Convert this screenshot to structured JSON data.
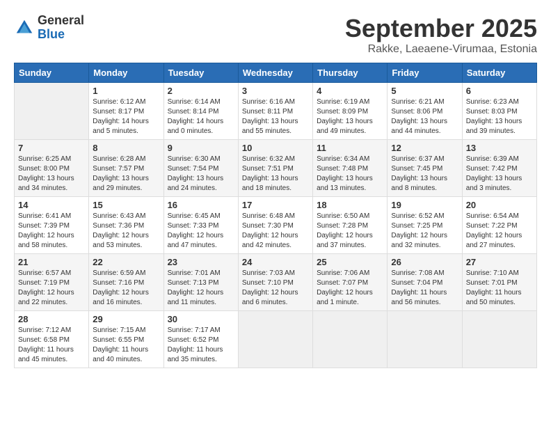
{
  "header": {
    "logo_general": "General",
    "logo_blue": "Blue",
    "month_title": "September 2025",
    "subtitle": "Rakke, Laeaene-Virumaa, Estonia"
  },
  "days_of_week": [
    "Sunday",
    "Monday",
    "Tuesday",
    "Wednesday",
    "Thursday",
    "Friday",
    "Saturday"
  ],
  "weeks": [
    [
      {
        "day": "",
        "empty": true
      },
      {
        "day": "1",
        "sunrise": "Sunrise: 6:12 AM",
        "sunset": "Sunset: 8:17 PM",
        "daylight": "Daylight: 14 hours and 5 minutes."
      },
      {
        "day": "2",
        "sunrise": "Sunrise: 6:14 AM",
        "sunset": "Sunset: 8:14 PM",
        "daylight": "Daylight: 14 hours and 0 minutes."
      },
      {
        "day": "3",
        "sunrise": "Sunrise: 6:16 AM",
        "sunset": "Sunset: 8:11 PM",
        "daylight": "Daylight: 13 hours and 55 minutes."
      },
      {
        "day": "4",
        "sunrise": "Sunrise: 6:19 AM",
        "sunset": "Sunset: 8:09 PM",
        "daylight": "Daylight: 13 hours and 49 minutes."
      },
      {
        "day": "5",
        "sunrise": "Sunrise: 6:21 AM",
        "sunset": "Sunset: 8:06 PM",
        "daylight": "Daylight: 13 hours and 44 minutes."
      },
      {
        "day": "6",
        "sunrise": "Sunrise: 6:23 AM",
        "sunset": "Sunset: 8:03 PM",
        "daylight": "Daylight: 13 hours and 39 minutes."
      }
    ],
    [
      {
        "day": "7",
        "sunrise": "Sunrise: 6:25 AM",
        "sunset": "Sunset: 8:00 PM",
        "daylight": "Daylight: 13 hours and 34 minutes."
      },
      {
        "day": "8",
        "sunrise": "Sunrise: 6:28 AM",
        "sunset": "Sunset: 7:57 PM",
        "daylight": "Daylight: 13 hours and 29 minutes."
      },
      {
        "day": "9",
        "sunrise": "Sunrise: 6:30 AM",
        "sunset": "Sunset: 7:54 PM",
        "daylight": "Daylight: 13 hours and 24 minutes."
      },
      {
        "day": "10",
        "sunrise": "Sunrise: 6:32 AM",
        "sunset": "Sunset: 7:51 PM",
        "daylight": "Daylight: 13 hours and 18 minutes."
      },
      {
        "day": "11",
        "sunrise": "Sunrise: 6:34 AM",
        "sunset": "Sunset: 7:48 PM",
        "daylight": "Daylight: 13 hours and 13 minutes."
      },
      {
        "day": "12",
        "sunrise": "Sunrise: 6:37 AM",
        "sunset": "Sunset: 7:45 PM",
        "daylight": "Daylight: 13 hours and 8 minutes."
      },
      {
        "day": "13",
        "sunrise": "Sunrise: 6:39 AM",
        "sunset": "Sunset: 7:42 PM",
        "daylight": "Daylight: 13 hours and 3 minutes."
      }
    ],
    [
      {
        "day": "14",
        "sunrise": "Sunrise: 6:41 AM",
        "sunset": "Sunset: 7:39 PM",
        "daylight": "Daylight: 12 hours and 58 minutes."
      },
      {
        "day": "15",
        "sunrise": "Sunrise: 6:43 AM",
        "sunset": "Sunset: 7:36 PM",
        "daylight": "Daylight: 12 hours and 53 minutes."
      },
      {
        "day": "16",
        "sunrise": "Sunrise: 6:45 AM",
        "sunset": "Sunset: 7:33 PM",
        "daylight": "Daylight: 12 hours and 47 minutes."
      },
      {
        "day": "17",
        "sunrise": "Sunrise: 6:48 AM",
        "sunset": "Sunset: 7:30 PM",
        "daylight": "Daylight: 12 hours and 42 minutes."
      },
      {
        "day": "18",
        "sunrise": "Sunrise: 6:50 AM",
        "sunset": "Sunset: 7:28 PM",
        "daylight": "Daylight: 12 hours and 37 minutes."
      },
      {
        "day": "19",
        "sunrise": "Sunrise: 6:52 AM",
        "sunset": "Sunset: 7:25 PM",
        "daylight": "Daylight: 12 hours and 32 minutes."
      },
      {
        "day": "20",
        "sunrise": "Sunrise: 6:54 AM",
        "sunset": "Sunset: 7:22 PM",
        "daylight": "Daylight: 12 hours and 27 minutes."
      }
    ],
    [
      {
        "day": "21",
        "sunrise": "Sunrise: 6:57 AM",
        "sunset": "Sunset: 7:19 PM",
        "daylight": "Daylight: 12 hours and 22 minutes."
      },
      {
        "day": "22",
        "sunrise": "Sunrise: 6:59 AM",
        "sunset": "Sunset: 7:16 PM",
        "daylight": "Daylight: 12 hours and 16 minutes."
      },
      {
        "day": "23",
        "sunrise": "Sunrise: 7:01 AM",
        "sunset": "Sunset: 7:13 PM",
        "daylight": "Daylight: 12 hours and 11 minutes."
      },
      {
        "day": "24",
        "sunrise": "Sunrise: 7:03 AM",
        "sunset": "Sunset: 7:10 PM",
        "daylight": "Daylight: 12 hours and 6 minutes."
      },
      {
        "day": "25",
        "sunrise": "Sunrise: 7:06 AM",
        "sunset": "Sunset: 7:07 PM",
        "daylight": "Daylight: 12 hours and 1 minute."
      },
      {
        "day": "26",
        "sunrise": "Sunrise: 7:08 AM",
        "sunset": "Sunset: 7:04 PM",
        "daylight": "Daylight: 11 hours and 56 minutes."
      },
      {
        "day": "27",
        "sunrise": "Sunrise: 7:10 AM",
        "sunset": "Sunset: 7:01 PM",
        "daylight": "Daylight: 11 hours and 50 minutes."
      }
    ],
    [
      {
        "day": "28",
        "sunrise": "Sunrise: 7:12 AM",
        "sunset": "Sunset: 6:58 PM",
        "daylight": "Daylight: 11 hours and 45 minutes."
      },
      {
        "day": "29",
        "sunrise": "Sunrise: 7:15 AM",
        "sunset": "Sunset: 6:55 PM",
        "daylight": "Daylight: 11 hours and 40 minutes."
      },
      {
        "day": "30",
        "sunrise": "Sunrise: 7:17 AM",
        "sunset": "Sunset: 6:52 PM",
        "daylight": "Daylight: 11 hours and 35 minutes."
      },
      {
        "day": "",
        "empty": true
      },
      {
        "day": "",
        "empty": true
      },
      {
        "day": "",
        "empty": true
      },
      {
        "day": "",
        "empty": true
      }
    ]
  ]
}
